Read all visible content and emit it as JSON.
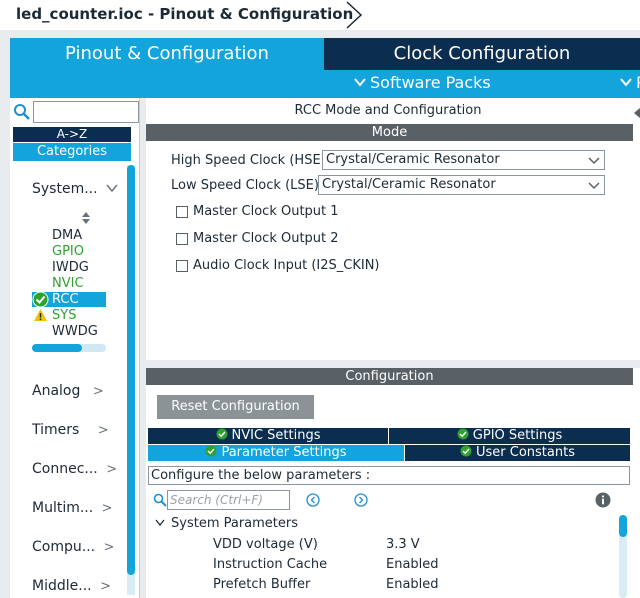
{
  "title": "led_counter.ioc - Pinout & Configuration",
  "tabs": {
    "pinout": "Pinout & Configuration",
    "clock": "Clock Configuration"
  },
  "subbar": {
    "software_packs": "Software Packs",
    "overflow": "P"
  },
  "left": {
    "sort_label": "A->Z",
    "categories_label": "Categories",
    "system_group": "System...",
    "peripherals": [
      "DMA",
      "GPIO",
      "IWDG",
      "NVIC",
      "RCC",
      "SYS",
      "WWDG"
    ],
    "groups": [
      "Analog",
      "Timers",
      "Connec...",
      "Multim...",
      "Compu...",
      "Middle..."
    ]
  },
  "rcc": {
    "panel_title": "RCC Mode and Configuration",
    "mode_header": "Mode",
    "hse_label": "High Speed Clock (HSE)",
    "hse_value": "Crystal/Ceramic Resonator",
    "lse_label": "Low Speed Clock (LSE)",
    "lse_value": "Crystal/Ceramic Resonator",
    "mco1": "Master Clock Output 1",
    "mco2": "Master Clock Output 2",
    "audio": "Audio Clock Input (I2S_CKIN)"
  },
  "config": {
    "header": "Configuration",
    "reset_button": "Reset Configuration",
    "tabs": [
      "NVIC Settings",
      "GPIO Settings",
      "Parameter Settings",
      "User Constants"
    ],
    "instruction": "Configure the below parameters :",
    "search_placeholder": "Search (Ctrl+F)",
    "group": "System Parameters",
    "params": [
      {
        "name": "VDD voltage (V)",
        "value": "3.3 V"
      },
      {
        "name": "Instruction Cache",
        "value": "Enabled"
      },
      {
        "name": "Prefetch Buffer",
        "value": "Enabled"
      }
    ]
  },
  "colors": {
    "accent": "#14a4dc",
    "navy": "#0b2d4f",
    "ok_green": "#2fa12f",
    "warn_yellow": "#f2c200"
  }
}
